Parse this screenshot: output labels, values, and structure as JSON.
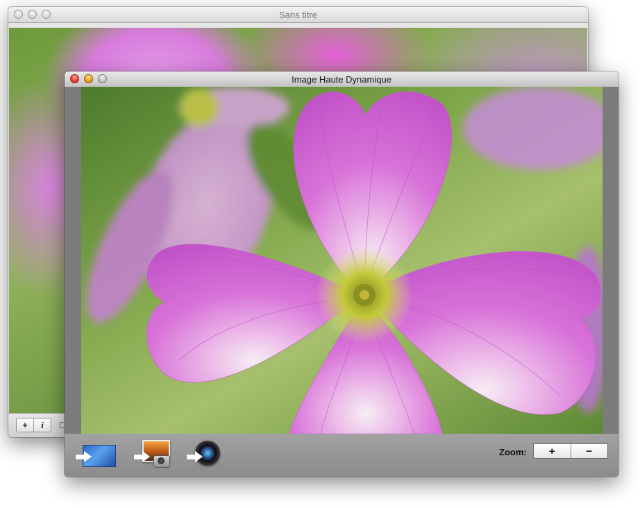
{
  "back_window": {
    "title": "Sans titre",
    "toolbar": {
      "add_label": "+",
      "info_label": "i"
    }
  },
  "front_window": {
    "title": "Image Haute Dynamique",
    "toolbar": {
      "zoom_label": "Zoom:",
      "zoom_in_label": "+",
      "zoom_out_label": "−"
    },
    "export_icons": [
      "set-desktop-icon",
      "iphoto-icon",
      "aperture-icon"
    ]
  },
  "colors": {
    "petal": "#d66fd8",
    "petal_light": "#f2d4f2",
    "center": "#b9c232",
    "close_red": "#ec4d3f",
    "minimize_yellow": "#f2a82b"
  }
}
